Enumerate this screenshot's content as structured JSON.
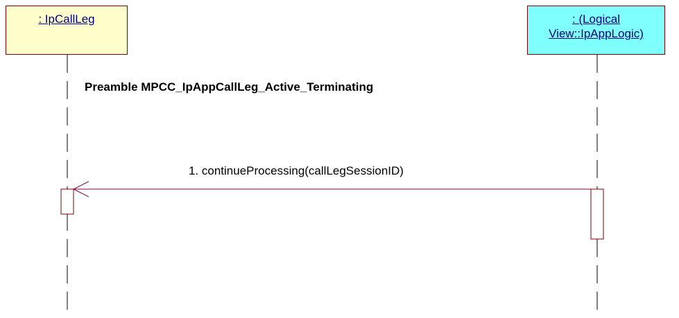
{
  "lifelines": [
    {
      "line1": ": IpCallLeg",
      "line2": ""
    },
    {
      "line1": ": (Logical",
      "line2": "View::IpAppLogic)"
    }
  ],
  "note": "Preamble MPCC_IpAppCallLeg_Active_Terminating",
  "message": {
    "label": "1. continueProcessing(callLegSessionID)"
  },
  "colors": {
    "left_box_fill": "#ffffcc",
    "right_box_fill": "#80ffff",
    "box_border": "#800000",
    "box_text": "#000080",
    "arrow": "#800040"
  }
}
